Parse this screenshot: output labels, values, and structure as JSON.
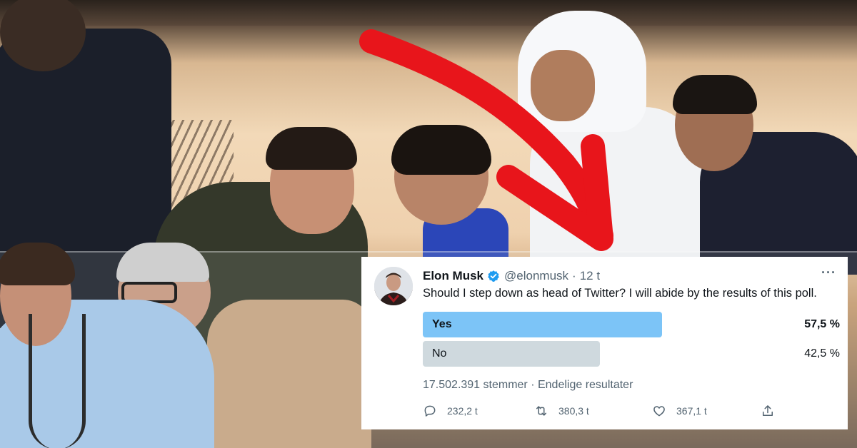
{
  "tweet": {
    "author_name": "Elon Musk",
    "handle": "@elonmusk",
    "separator": "·",
    "time": "12 t",
    "more": "···",
    "text": "Should I step down as head of Twitter? I will abide by the results of this poll.",
    "poll": {
      "options": [
        {
          "label": "Yes",
          "percent_text": "57,5 %",
          "fraction": 0.575,
          "color": "#7cc4f7"
        },
        {
          "label": "No",
          "percent_text": "42,5 %",
          "fraction": 0.425,
          "color": "#cfd9de"
        }
      ],
      "votes": "17.502.391 stemmer",
      "status": "Endelige resultater"
    },
    "actions": {
      "replies": "232,2 t",
      "retweets": "380,3 t",
      "likes": "367,1 t"
    },
    "icons": [
      "verified-badge-icon",
      "more-icon",
      "reply-icon",
      "retweet-icon",
      "like-icon",
      "share-icon"
    ],
    "colors": {
      "verified": "#1d9bf0",
      "arrow": "#e8151b"
    }
  }
}
